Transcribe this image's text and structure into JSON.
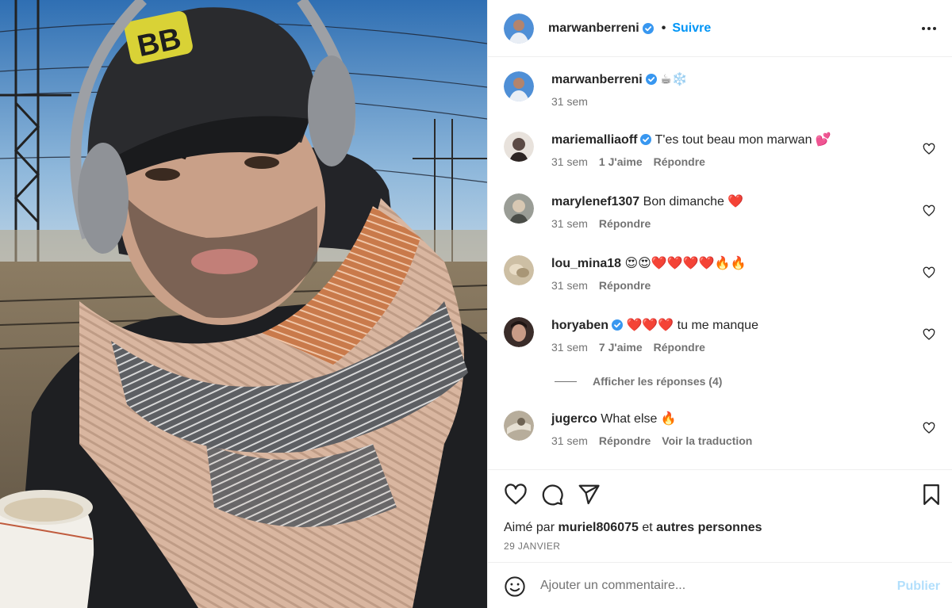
{
  "post": {
    "author": "marwanberreni",
    "follow_label": "Suivre",
    "separator": "•",
    "caption": "☕❄️",
    "caption_time": "31 sem"
  },
  "comments": [
    {
      "user": "mariemalliaoff",
      "verified": true,
      "text": "T'es tout beau mon marwan 💕",
      "time": "31 sem",
      "likes": "1 J'aime",
      "reply": "Répondre",
      "avatar_color": "#5b4a45"
    },
    {
      "user": "marylenef1307",
      "verified": false,
      "text": "Bon dimanche ❤️",
      "time": "31 sem",
      "likes": "",
      "reply": "Répondre",
      "avatar_color": "#9a9d96"
    },
    {
      "user": "lou_mina18",
      "verified": false,
      "text": "😍😍❤️❤️❤️❤️🔥🔥",
      "time": "31 sem",
      "likes": "",
      "reply": "Répondre",
      "avatar_color": "#cdbfa4"
    },
    {
      "user": "horyaben",
      "verified": true,
      "text": "❤️❤️❤️ tu me manque",
      "time": "31 sem",
      "likes": "7 J'aime",
      "reply": "Répondre",
      "avatar_color": "#3a2c29"
    },
    {
      "user": "jugerco",
      "verified": false,
      "text": "What else 🔥",
      "time": "31 sem",
      "likes": "",
      "reply": "Répondre",
      "translate": "Voir la traduction",
      "avatar_color": "#b7ad9b"
    }
  ],
  "show_replies": "Afficher les réponses (4)",
  "liked_by": {
    "prefix": "Aimé par",
    "user": "muriel806075",
    "joiner": "et",
    "others": "autres personnes"
  },
  "date": "29 JANVIER",
  "composer": {
    "placeholder": "Ajouter un commentaire...",
    "publish_label": "Publier"
  },
  "icons": {
    "like": "heart-icon",
    "comment": "comment-icon",
    "share": "send-icon",
    "save": "bookmark-icon",
    "more": "more-options-icon",
    "emoji": "emoji-icon",
    "verified": "verified-badge-icon"
  },
  "colors": {
    "accent": "#0095f6",
    "verified": "#3897f0",
    "muted": "#737373",
    "publish_disabled": "#b2dffc"
  }
}
